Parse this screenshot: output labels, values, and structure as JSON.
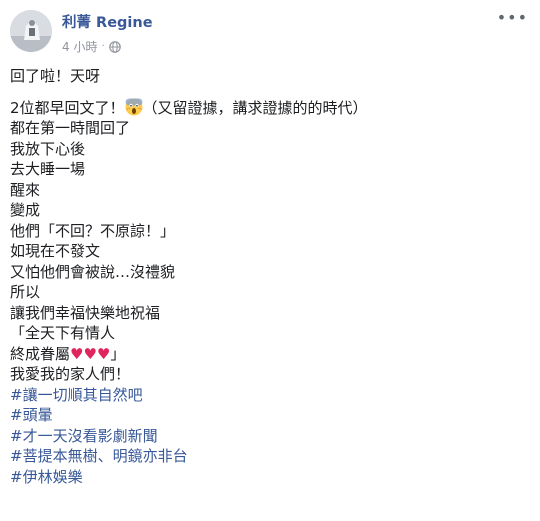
{
  "author": {
    "name": "利菁 Regine"
  },
  "meta": {
    "time": "4 小時",
    "privacy_icon": "globe-icon"
  },
  "menu_icon": "more-options-icon",
  "post": {
    "first_line": "回了啦！天呀",
    "line2_before": "2位都早回文了！",
    "line2_emoji": "scream-emoji",
    "line2_after": "（又留證據，講求證據的的時代）",
    "lines": [
      "都在第一時間回了",
      "我放下心後",
      "去大睡一場",
      "醒來",
      "變成",
      "他們「不回？不原諒！」",
      "如現在不發文",
      "又怕他們會被說…沒禮貌",
      "所以",
      "讓我們幸福快樂地祝福",
      "「全天下有情人"
    ],
    "heart_line_text": "終成眷屬",
    "heart_line_hearts": "♥♥♥",
    "heart_line_end": "」",
    "last_line": "我愛我的家人們！",
    "hashtags": [
      "#讓一切順其自然吧",
      "#頭暈",
      "#才一天沒看影劇新聞",
      "#菩提本無樹、明鏡亦非台",
      "#伊林娛樂"
    ]
  },
  "colors": {
    "link": "#385898",
    "meta": "#90949c",
    "heart": "#e0245e"
  }
}
